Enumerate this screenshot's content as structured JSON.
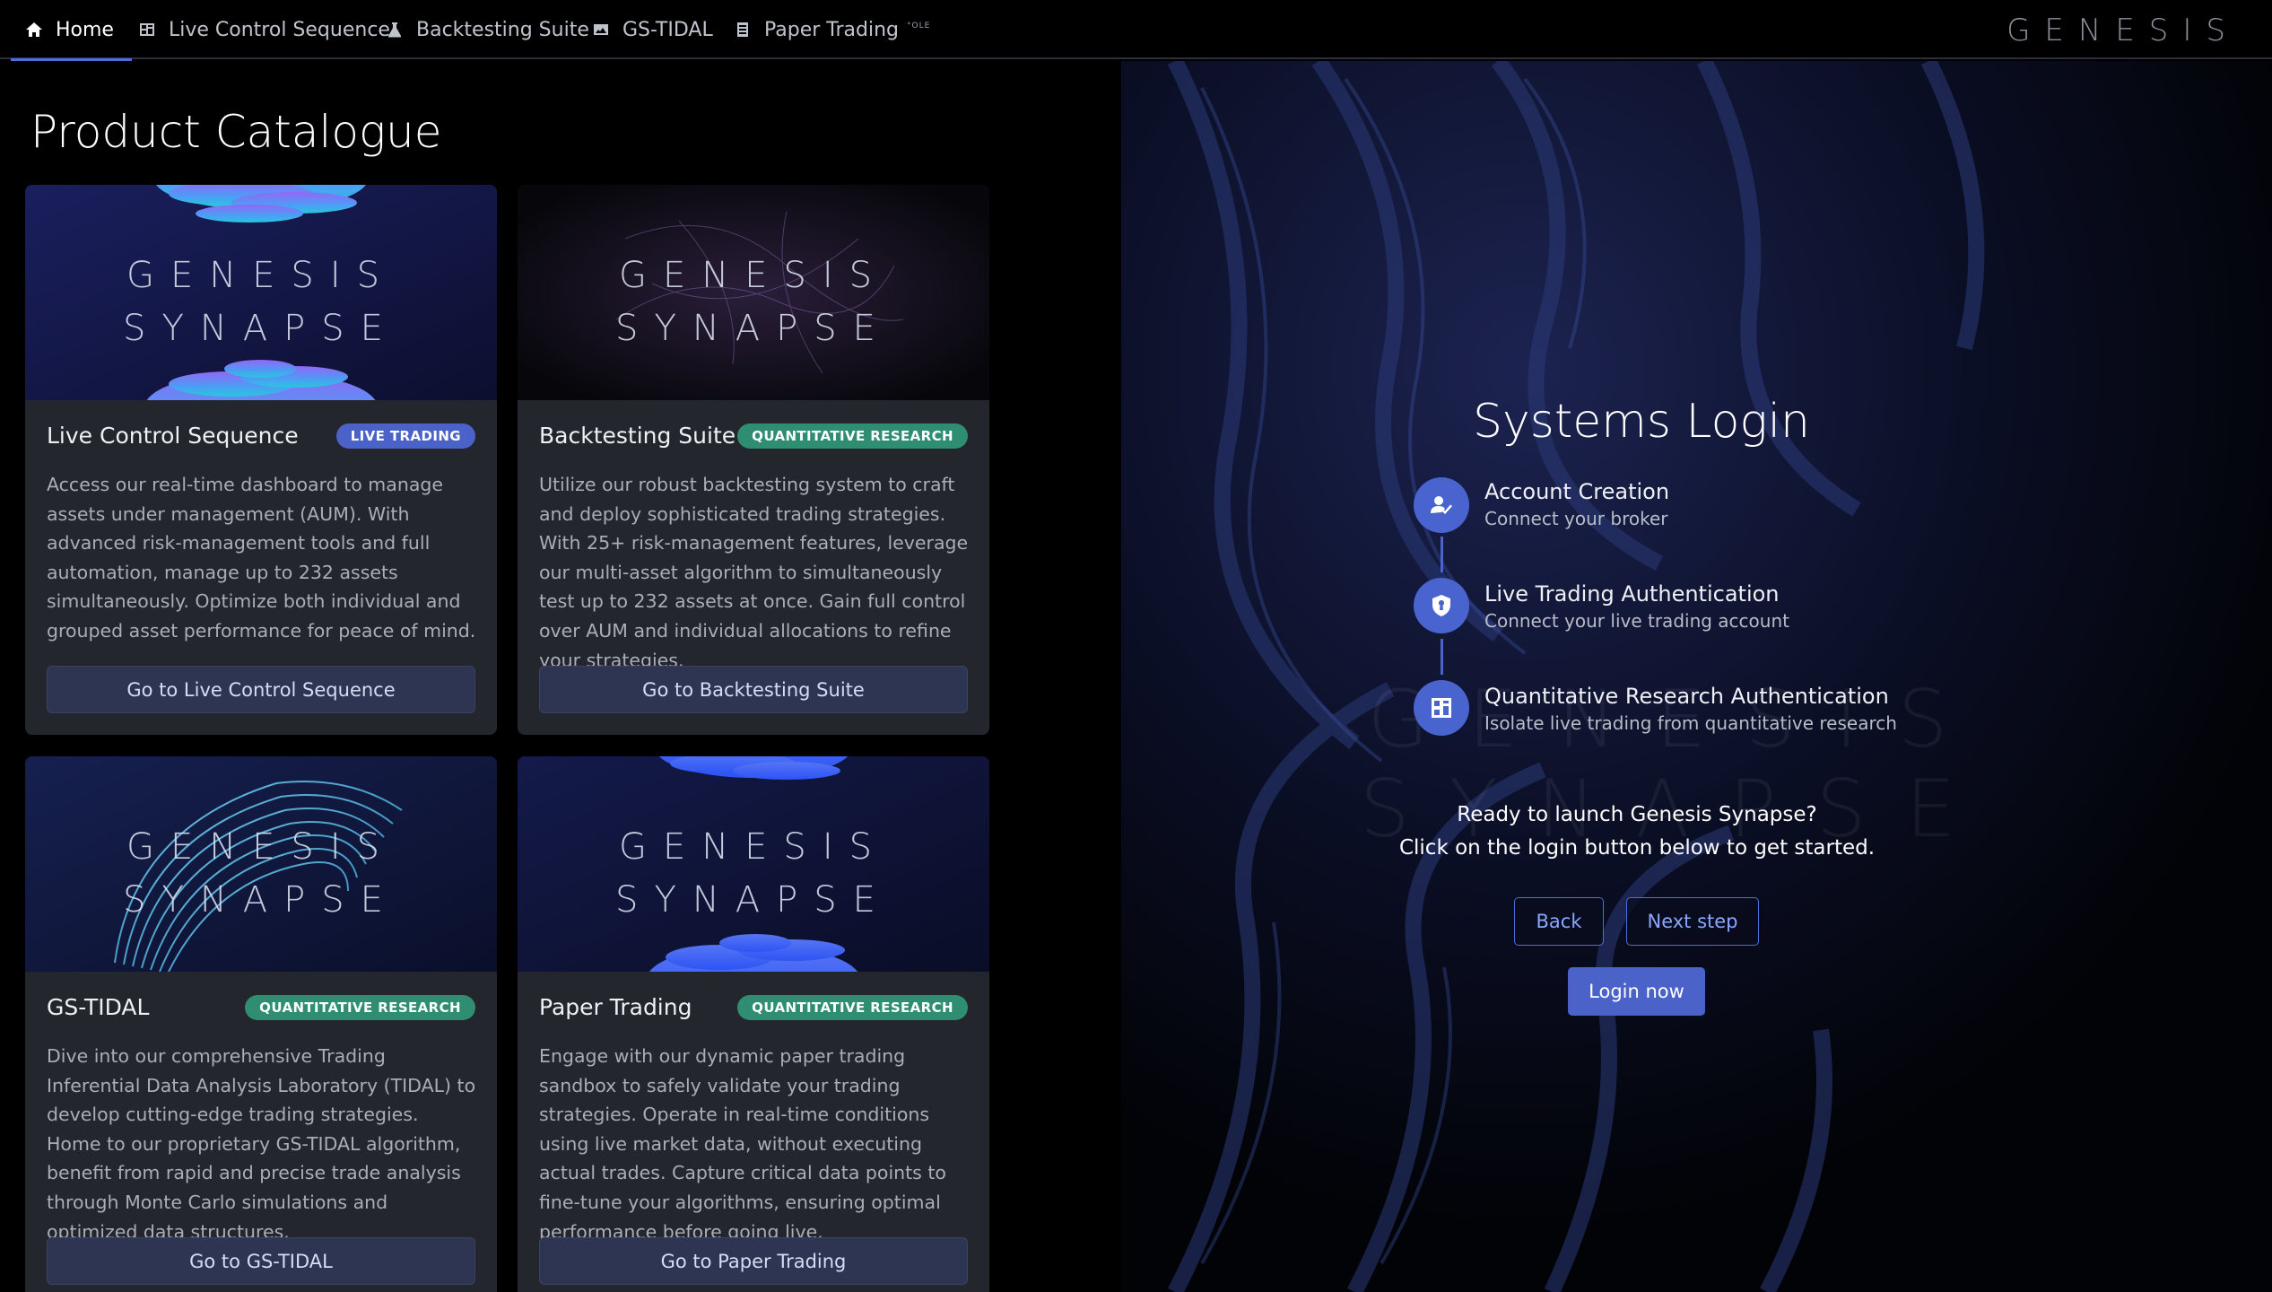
{
  "nav": {
    "tabs": [
      {
        "label": "Home",
        "icon": "home-icon"
      },
      {
        "label": "Live Control Sequence",
        "icon": "dashboard-icon"
      },
      {
        "label": "Backtesting Suite",
        "icon": "flask-icon"
      },
      {
        "label": "GS-TIDAL",
        "icon": "chart-image-icon"
      },
      {
        "label": "Paper Trading",
        "icon": "document-icon"
      }
    ],
    "overflow_label": "°OLE",
    "brand": "GENESIS"
  },
  "catalogue": {
    "title": "Product Catalogue",
    "cards": [
      {
        "banner_line1": "GENESIS",
        "banner_line2": "SYNAPSE",
        "title": "Live Control Sequence",
        "badge": "LIVE TRADING",
        "description": "Access our real-time dashboard to manage assets under management (AUM). With advanced risk-management tools and full automation, manage up to 232 assets simultaneously. Optimize both individual and grouped asset performance for peace of mind.",
        "button": "Go to Live Control Sequence"
      },
      {
        "banner_line1": "GENESIS",
        "banner_line2": "SYNAPSE",
        "title": "Backtesting Suite",
        "badge": "QUANTITATIVE RESEARCH",
        "description": "Utilize our robust backtesting system to craft and deploy sophisticated trading strategies. With 25+ risk-management features, leverage our multi-asset algorithm to simultaneously test up to 232 assets at once. Gain full control over AUM and individual allocations to refine your strategies.",
        "button": "Go to Backtesting Suite"
      },
      {
        "banner_line1": "GENESIS",
        "banner_line2": "SYNAPSE",
        "title": "GS-TIDAL",
        "badge": "QUANTITATIVE RESEARCH",
        "description": "Dive into our comprehensive Trading Inferential Data Analysis Laboratory (TIDAL) to develop cutting-edge trading strategies. Home to our proprietary GS-TIDAL algorithm, benefit from rapid and precise trade analysis through Monte Carlo simulations and optimized data structures.",
        "button": "Go to GS-TIDAL"
      },
      {
        "banner_line1": "GENESIS",
        "banner_line2": "SYNAPSE",
        "title": "Paper Trading",
        "badge": "QUANTITATIVE RESEARCH",
        "description": "Engage with our dynamic paper trading sandbox to safely validate your trading strategies. Operate in real-time conditions using live market data, without executing actual trades. Capture critical data points to fine-tune your algorithms, ensuring optimal performance before going live.",
        "button": "Go to Paper Trading"
      }
    ]
  },
  "login": {
    "title": "Systems Login",
    "watermark_line1": "GENESIS",
    "watermark_line2": "SYNAPSE",
    "steps": [
      {
        "title": "Account Creation",
        "subtitle": "Connect your broker",
        "icon": "user-check-icon"
      },
      {
        "title": "Live Trading Authentication",
        "subtitle": "Connect your live trading account",
        "icon": "shield-icon"
      },
      {
        "title": "Quantitative Research Authentication",
        "subtitle": "Isolate live trading from quantitative research",
        "icon": "grid-icon"
      }
    ],
    "message_line1": "Ready to launch Genesis Synapse?",
    "message_line2": "Click on the login button below to get started.",
    "back": "Back",
    "next": "Next step",
    "login_now": "Login now"
  },
  "colors": {
    "accent": "#4b63c9",
    "badge_quant": "#2f8d72",
    "card_bg": "#23262d",
    "page_bg": "#000000"
  }
}
